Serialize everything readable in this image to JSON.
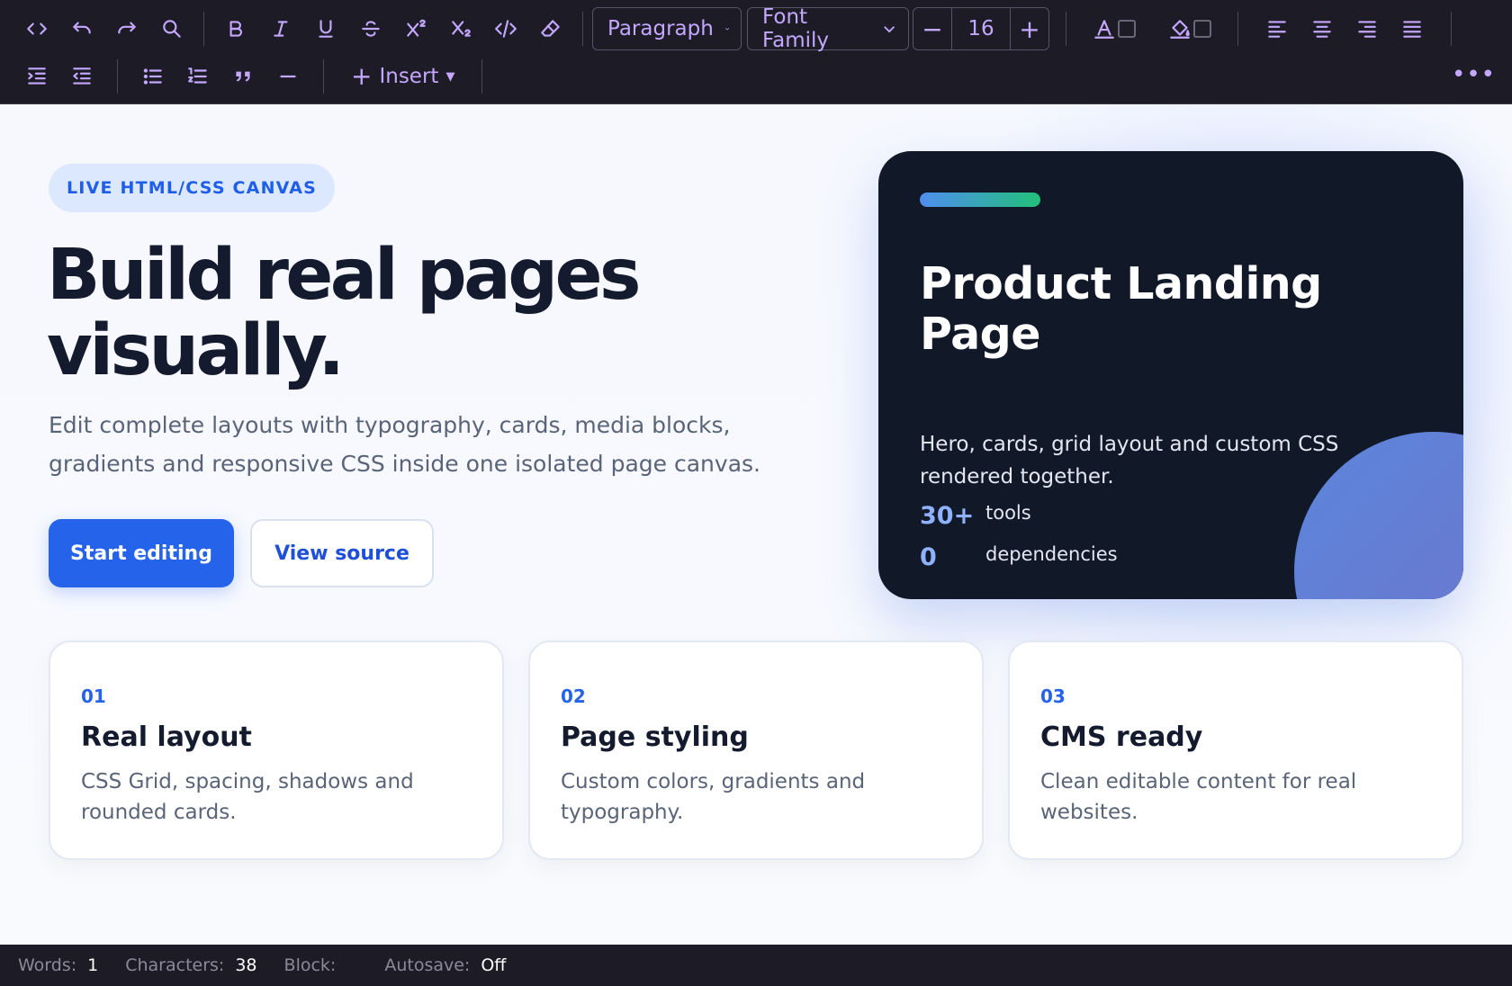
{
  "toolbar": {
    "row1": [
      {
        "name": "source-code-icon"
      },
      {
        "name": "undo-icon"
      },
      {
        "name": "redo-icon"
      },
      {
        "name": "search-icon"
      },
      {
        "name": "bold-icon"
      },
      {
        "name": "italic-icon"
      },
      {
        "name": "underline-icon"
      },
      {
        "name": "strikethrough-icon"
      },
      {
        "name": "superscript-icon"
      },
      {
        "name": "subscript-icon"
      },
      {
        "name": "inline-code-icon"
      },
      {
        "name": "eraser-icon"
      }
    ],
    "block_format": "Paragraph",
    "font_family": "Font Family",
    "font_size": "16",
    "minus": "−",
    "plus": "+",
    "insert_label": "Insert",
    "more_label": "•••"
  },
  "hero": {
    "eyebrow": "LIVE HTML/CSS CANVAS",
    "title": "Build real pages visually.",
    "lead": "Edit complete layouts with typography, cards, media blocks, gradients and responsive CSS inside one isolated page canvas.",
    "primary_button": "Start editing",
    "secondary_button": "View source"
  },
  "showcase_card": {
    "title": "Product Landing Page",
    "text": "Hero, cards, grid layout and custom CSS rendered together.",
    "stats": [
      {
        "value": "30+",
        "label": "tools"
      },
      {
        "value": "0",
        "label": "dependencies"
      }
    ]
  },
  "features": [
    {
      "number": "01",
      "title": "Real layout",
      "text": "CSS Grid, spacing, shadows and rounded cards."
    },
    {
      "number": "02",
      "title": "Page styling",
      "text": "Custom colors, gradients and typography."
    },
    {
      "number": "03",
      "title": "CMS ready",
      "text": "Clean editable content for real websites."
    }
  ],
  "status": {
    "words_label": "Words:",
    "words_value": "1",
    "chars_label": "Characters:",
    "chars_value": "38",
    "block_label": "Block:",
    "block_value": "",
    "autosave_label": "Autosave:",
    "autosave_value": "Off"
  },
  "colors": {
    "toolbar_bg": "#1c1b26",
    "toolbar_icon": "#c4a7ff",
    "accent": "#2563eb",
    "dark_card": "#111828"
  }
}
